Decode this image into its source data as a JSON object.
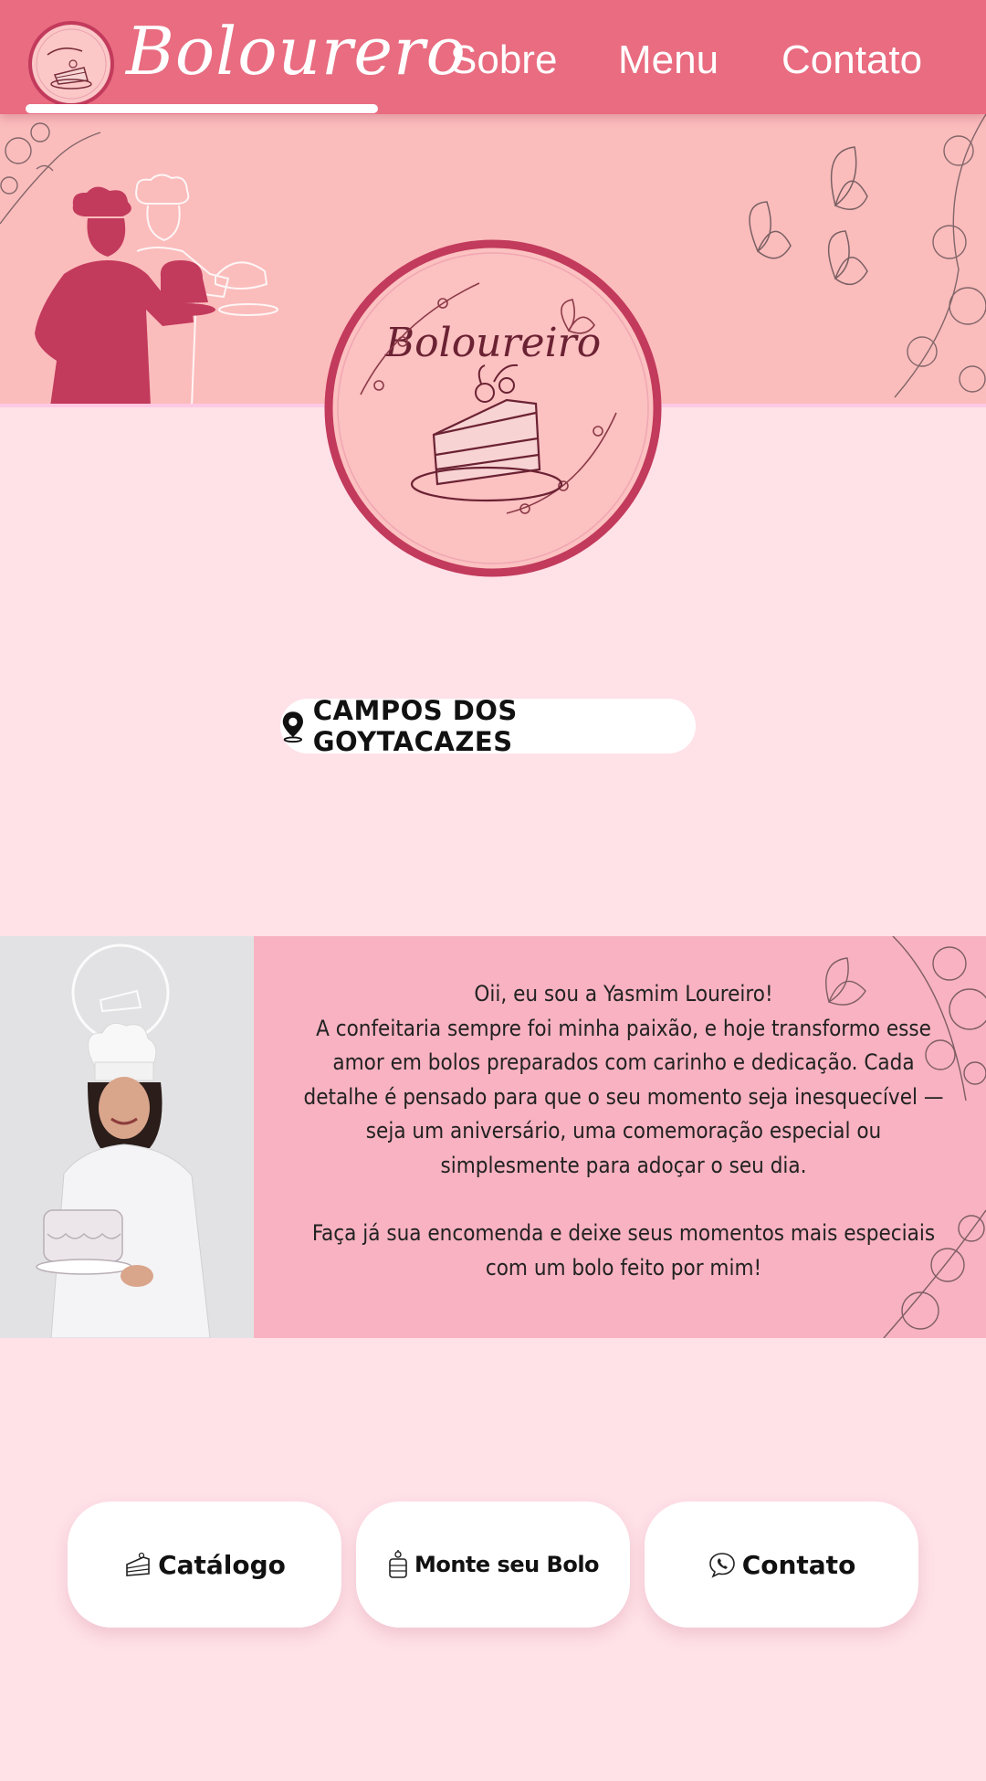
{
  "header": {
    "brand": "Bolourero",
    "nav": [
      "Sobre",
      "Menu",
      "Contato"
    ]
  },
  "hero": {
    "logo_text": "Boloureiro",
    "location": "CAMPOS DOS GOYTACAZES"
  },
  "about": {
    "line1": "Oii, eu sou a Yasmim Loureiro!",
    "paragraph1": "A confeitaria sempre foi minha paixão, e hoje transformo esse amor em bolos preparados com carinho e dedicação. Cada detalhe é pensado para que o seu momento seja inesquecível — seja um aniversário, uma comemoração especial ou simplesmente para adoçar o seu dia.",
    "paragraph2": "Faça já sua encomenda e deixe seus momentos mais especiais com um bolo feito por mim!"
  },
  "actions": [
    {
      "label": "Catálogo",
      "icon": "cake-slice-icon"
    },
    {
      "label": "Monte seu Bolo",
      "icon": "layer-cake-icon"
    },
    {
      "label": "Contato",
      "icon": "chat-phone-icon"
    }
  ],
  "colors": {
    "header": "#e96c80",
    "banner": "#fbbcbc",
    "page": "#ffe1e8",
    "about_panel": "#f8b2c1",
    "accent_dark": "#c23a5c"
  }
}
